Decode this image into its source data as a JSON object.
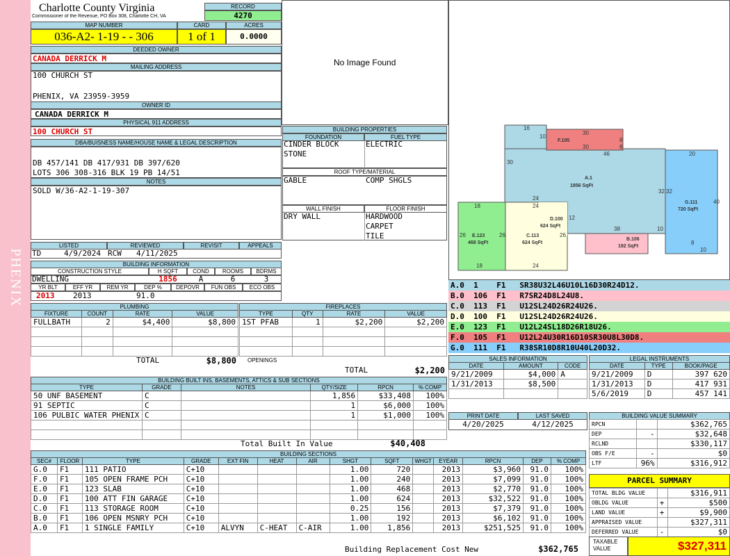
{
  "side_label": "PHENIX",
  "county": "Charlotte County Virginia",
  "commissioner": "Commissioner of the Revenue, PO Box 308, Charlotte CH, VA",
  "record": {
    "label": "RECORD",
    "value": "4270"
  },
  "map": {
    "label": "MAP NUMBER",
    "value": "036-A2- 1-19 -   - 306"
  },
  "card": {
    "label": "CARD",
    "value": "1 of 1"
  },
  "acres": {
    "label": "ACRES",
    "value": "0.0000"
  },
  "deeded_owner": {
    "label": "DEEDED OWNER",
    "value": "CANADA DERRICK M"
  },
  "mailing": {
    "label": "MAILING ADDRESS",
    "line1": "100 CHURCH ST",
    "line2": "PHENIX, VA 23959-3959"
  },
  "owner_id": {
    "label": "OWNER ID",
    "value": "CANADA DERRICK M"
  },
  "physical": {
    "label": "PHYSICAL 911 ADDRESS",
    "value": "100 CHURCH ST"
  },
  "legal": {
    "label": "DBA/BUISNESS NAME/HOUSE NAME & LEGAL DESCRIPTION",
    "line1": "DB 457/141 DB 417/931 DB 397/620",
    "line2": "LOTS 306 308-316 BLK 19 PB 14/51"
  },
  "notes": {
    "label": "NOTES",
    "value": "SOLD W/36-A2-1-19-307"
  },
  "image": {
    "text": "No Image Found"
  },
  "building_props": {
    "label": "BUILDING PROPERTIES",
    "foundation_label": "FOUNDATION",
    "fuel_label": "FUEL TYPE",
    "foundation1": "CINDER BLOCK",
    "foundation2": "STONE",
    "fuel": "ELECTRIC",
    "roof_label": "ROOF TYPE/MATERIAL",
    "roof1": "GABLE",
    "roof2": "COMP SHGLS",
    "wall_label": "WALL FINISH",
    "floor_label": "FLOOR FINISH",
    "wall": "DRY WALL",
    "floor1": "HARDWOOD",
    "floor2": "CARPET",
    "floor3": "TILE"
  },
  "review": {
    "listed_label": "LISTED",
    "reviewed_label": "REVIEWED",
    "revisit_label": "REVISIT",
    "appeals_label": "APPEALS",
    "listed_by": "TD",
    "listed_date": "4/9/2024",
    "reviewed_by": "RCW",
    "reviewed_date": "4/11/2025"
  },
  "bldg_info": {
    "label": "BUILDING INFORMATION",
    "style_label": "CONSTRUCTION STYLE",
    "hsqft_label": "H SQFT",
    "cond_label": "COND",
    "rooms_label": "ROOMS",
    "bdrms_label": "BDRMS",
    "style": "DWELLING",
    "hsqft": "1856",
    "cond": "A",
    "rooms": "6",
    "bdrms": "3",
    "yrblt_label": "YR BLT",
    "effyr_label": "EFF YR",
    "remyr_label": "REM YR",
    "dep_label": "DEP %",
    "depovr_label": "DEPOVR",
    "funobs_label": "FUN OBS",
    "ecoobs_label": "ECO OBS",
    "yrblt": "2013",
    "effyr": "2013",
    "dep": "91.0"
  },
  "plumbing": {
    "label": "PLUMBING",
    "headers": [
      "FIXTURE",
      "COUNT",
      "RATE",
      "VALUE"
    ],
    "rows": [
      [
        "FULLBATH",
        "2",
        "$4,400",
        "$8,800"
      ]
    ],
    "total_label": "TOTAL",
    "total": "$8,800"
  },
  "fireplaces": {
    "label": "FIREPLACES",
    "headers": [
      "TYPE",
      "QTY",
      "RATE",
      "VALUE"
    ],
    "rows": [
      [
        "1ST PFAB",
        "1",
        "$2,200",
        "$2,200"
      ]
    ],
    "openings_label": "OPENINGS",
    "total_label": "TOTAL",
    "total": "$2,200"
  },
  "builtins": {
    "label": "BUILDING BUILT INS, BASEMENTS, ATTICS & SUB SECTIONS",
    "headers": [
      "TYPE",
      "GRADE",
      "NOTES",
      "QTY/SIZE",
      "RPCN",
      "% COMP"
    ],
    "rows": [
      [
        "50 UNF BASEMENT",
        "C",
        "",
        "1,856",
        "$33,408",
        "100%"
      ],
      [
        "91 SEPTIC",
        "C",
        "",
        "1",
        "$6,000",
        "100%"
      ],
      [
        "106 PULBIC WATER PHENIX",
        "C",
        "",
        "1",
        "$1,000",
        "100%"
      ]
    ],
    "total_label": "Total Built In Value",
    "total": "$40,408"
  },
  "sections": {
    "label": "BUILDING SECTIONS",
    "headers": [
      "SEC#",
      "FLOOR",
      "TYPE",
      "GRADE",
      "EXT FIN",
      "HEAT",
      "AIR",
      "SHGT",
      "SQFT",
      "WHGT",
      "EYEAR",
      "RPCN",
      "DEP",
      "% COMP"
    ],
    "rows": [
      [
        "G.0",
        "F1",
        "111 PATIO",
        "C+10",
        "",
        "",
        "",
        "1.00",
        "720",
        "",
        "2013",
        "$3,960",
        "91.0",
        "100%"
      ],
      [
        "F.0",
        "F1",
        "105 OPEN FRAME PCH",
        "C+10",
        "",
        "",
        "",
        "1.00",
        "240",
        "",
        "2013",
        "$7,099",
        "91.0",
        "100%"
      ],
      [
        "E.0",
        "F1",
        "123 SLAB",
        "C+10",
        "",
        "",
        "",
        "1.00",
        "468",
        "",
        "2013",
        "$2,770",
        "91.0",
        "100%"
      ],
      [
        "D.0",
        "F1",
        "100 ATT FIN GARAGE",
        "C+10",
        "",
        "",
        "",
        "1.00",
        "624",
        "",
        "2013",
        "$32,522",
        "91.0",
        "100%"
      ],
      [
        "C.0",
        "F1",
        "113 STORAGE ROOM",
        "C+10",
        "",
        "",
        "",
        "0.25",
        "156",
        "",
        "2013",
        "$7,379",
        "91.0",
        "100%"
      ],
      [
        "B.0",
        "F1",
        "106 OPEN MSNRY PCH",
        "C+10",
        "",
        "",
        "",
        "1.00",
        "192",
        "",
        "2013",
        "$6,102",
        "91.0",
        "100%"
      ],
      [
        "A.0",
        "F1",
        "1 SINGLE FAMILY",
        "C+10",
        "ALVYN",
        "C-HEAT",
        "C-AIR",
        "1.00",
        "1,856",
        "",
        "2013",
        "$251,525",
        "91.0",
        "100%"
      ]
    ],
    "total_label": "Building Replacement Cost New",
    "total": "$362,765"
  },
  "sketch": {
    "areas": [
      {
        "id": "F.105",
        "sqft": ""
      },
      {
        "id": "A.1",
        "sqft": "1856 SqFt"
      },
      {
        "id": "G.111",
        "sqft": "720 SqFt"
      },
      {
        "id": "D.100",
        "sqft": "624 SqFt"
      },
      {
        "id": "E.123",
        "sqft": "468 SqFt"
      },
      {
        "id": "C.113",
        "sqft": "624 SqFt"
      },
      {
        "id": "B.106",
        "sqft": "192 SqFt"
      }
    ],
    "dims": [
      "16",
      "10",
      "30",
      "8",
      "30",
      "8",
      "46",
      "20",
      "30",
      "32",
      "32",
      "40",
      "24",
      "18",
      "24",
      "12",
      "38",
      "10",
      "26",
      "26",
      "26",
      "8",
      "10",
      "18",
      "24"
    ],
    "segments": [
      {
        "text": "A.0  1    F1   SR38U32L46U10L16D30R24D12.",
        "color": "#add8e6"
      },
      {
        "text": "B.0  106  F1   R7SR24D8L24U8.",
        "color": "#ffc0cb"
      },
      {
        "text": "C.0  113  F1   U12SL24D26R24U26.",
        "color": "#d3d3d3"
      },
      {
        "text": "D.0  100  F1   U12SL24D26R24U26.",
        "color": "#ffffe0"
      },
      {
        "text": "E.0  123  F1   U12L24SL18D26R18U26.",
        "color": "#90ee90"
      },
      {
        "text": "F.0  105  F1   U12L24U30R16D10SR30U8L30D8.",
        "color": "#f08080"
      },
      {
        "text": "G.0  111  F1   R38SR10D8R10U40L20D32.",
        "color": "#87cefa"
      }
    ]
  },
  "sales": {
    "label": "SALES INFORMATION",
    "headers": [
      "DATE",
      "AMOUNT",
      "CODE"
    ],
    "rows": [
      [
        "9/21/2009",
        "$4,000",
        "A"
      ],
      [
        "1/31/2013",
        "$8,500",
        ""
      ]
    ]
  },
  "legal_inst": {
    "label": "LEGAL INSTRUMENTS",
    "headers": [
      "DATE",
      "TYPE",
      "BOOK/PAGE"
    ],
    "rows": [
      [
        "9/21/2009",
        "D",
        "397 620"
      ],
      [
        "1/31/2013",
        "D",
        "417 931"
      ],
      [
        "5/6/2019",
        "D",
        "457 141"
      ]
    ]
  },
  "print": {
    "print_label": "PRINT DATE",
    "saved_label": "LAST SAVED",
    "print_date": "4/20/2025",
    "saved_date": "4/12/2025"
  },
  "bvs": {
    "label": "BUILDING VALUE SUMMARY",
    "rows": [
      [
        "RPCN",
        "",
        "$362,765"
      ],
      [
        "DEP",
        "-",
        "$32,648"
      ],
      [
        "RCLND",
        "",
        "$330,117"
      ],
      [
        "OBS F/E",
        "-",
        "$0"
      ],
      [
        "LTF",
        "96%",
        "$316,912"
      ]
    ]
  },
  "parcel": {
    "label": "PARCEL SUMMARY",
    "rows": [
      [
        "TOTAL BLDG VALUE",
        "",
        "$316,911"
      ],
      [
        "OBLDG VALUE",
        "+",
        "$500"
      ],
      [
        "LAND VALUE",
        "+",
        "$9,900"
      ],
      [
        "APPRAISED VALUE",
        "",
        "$327,311"
      ],
      [
        "DEFERRED VALUE",
        "-",
        "$0"
      ]
    ],
    "taxable_label1": "TAXABLE",
    "taxable_label2": "VALUE",
    "taxable": "$327,311"
  }
}
